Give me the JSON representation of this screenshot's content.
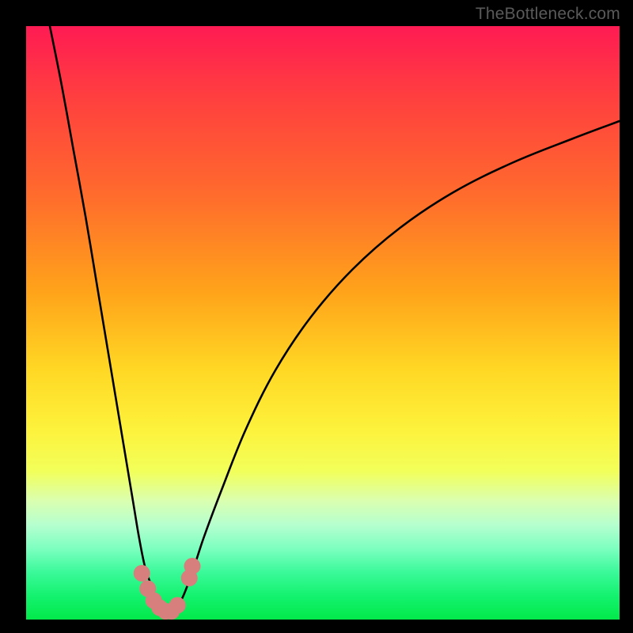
{
  "attribution": "TheBottleneck.com",
  "colors": {
    "frame": "#000000",
    "curve_stroke": "#000000",
    "marker_fill": "#d77f7c",
    "gradient_top": "#ff1b53",
    "gradient_bottom": "#03e94a"
  },
  "chart_data": {
    "type": "line",
    "title": "",
    "xlabel": "",
    "ylabel": "",
    "xlim": [
      0,
      100
    ],
    "ylim": [
      0,
      100
    ],
    "grid": false,
    "series": [
      {
        "name": "left-branch",
        "x": [
          4,
          6,
          8,
          10,
          12,
          14,
          16,
          18,
          19,
          20,
          21,
          22,
          23,
          24
        ],
        "y": [
          100,
          90,
          79,
          68,
          56,
          44,
          32,
          20,
          14,
          9,
          6,
          3.5,
          2,
          1.2
        ]
      },
      {
        "name": "right-branch",
        "x": [
          24,
          26,
          28,
          30,
          33,
          37,
          42,
          48,
          55,
          63,
          72,
          82,
          92,
          100
        ],
        "y": [
          1.2,
          3,
          8,
          14,
          22,
          32,
          42,
          51,
          59,
          66,
          72,
          77,
          81,
          84
        ]
      }
    ],
    "markers": [
      {
        "x": 19.5,
        "y": 7.8,
        "r": 1.4
      },
      {
        "x": 20.5,
        "y": 5.2,
        "r": 1.4
      },
      {
        "x": 21.5,
        "y": 3.2,
        "r": 1.4
      },
      {
        "x": 22.5,
        "y": 2.0,
        "r": 1.4
      },
      {
        "x": 23.5,
        "y": 1.4,
        "r": 1.4
      },
      {
        "x": 24.5,
        "y": 1.4,
        "r": 1.4
      },
      {
        "x": 25.5,
        "y": 2.4,
        "r": 1.4
      },
      {
        "x": 27.5,
        "y": 7.0,
        "r": 1.4
      },
      {
        "x": 28.0,
        "y": 9.0,
        "r": 1.4
      }
    ],
    "annotations": []
  }
}
